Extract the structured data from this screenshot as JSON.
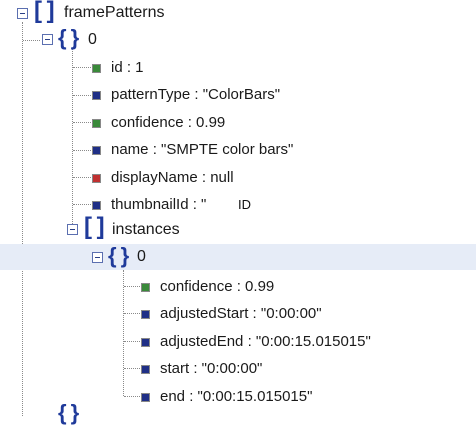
{
  "tree": {
    "root": {
      "label": "framePatterns"
    },
    "pattern": {
      "index_label": "0",
      "fields": [
        {
          "text": "id : 1",
          "color": "#3a8a3a"
        },
        {
          "text": "patternType : \"ColorBars\"",
          "color": "#1f2f86"
        },
        {
          "text": "confidence : 0.99",
          "color": "#3a8a3a"
        },
        {
          "text": "name : \"SMPTE color bars\"",
          "color": "#1f2f86"
        },
        {
          "text": "displayName : null",
          "color": "#c03030"
        },
        {
          "text": "thumbnailId : \"",
          "color": "#1f2f86"
        }
      ],
      "overlay_label": "ID",
      "instances": {
        "label": "instances",
        "item": {
          "index_label": "0",
          "fields": [
            {
              "text": "confidence : 0.99",
              "color": "#3a8a3a"
            },
            {
              "text": "adjustedStart : \"0:00:00\"",
              "color": "#1f2f86"
            },
            {
              "text": "adjustedEnd : \"0:00:15.015015\"",
              "color": "#1f2f86"
            },
            {
              "text": "start : \"0:00:00\"",
              "color": "#1f2f86"
            },
            {
              "text": "end : \"0:00:15.015015\"",
              "color": "#1f2f86"
            }
          ]
        }
      }
    }
  },
  "colors": {
    "bracket": "#1f3a9a",
    "selected_row": "#e6ecf7",
    "guide": "#8a8a8a"
  }
}
